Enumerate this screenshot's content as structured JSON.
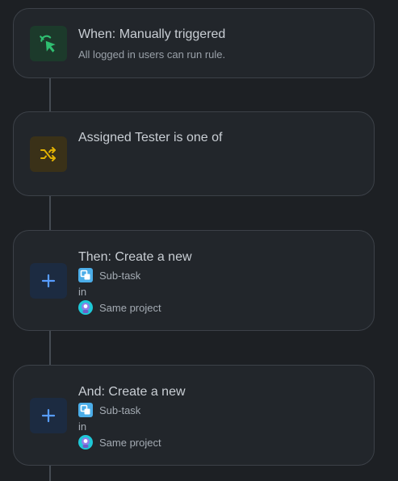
{
  "colors": {
    "background": "#1d2024",
    "card": "#22262b",
    "card_border": "#3c4148",
    "connector": "#454b53",
    "trigger_accent": "#2fbf71",
    "condition_accent": "#e2b203",
    "action_accent": "#579dff",
    "subtask_accent": "#4bade8",
    "project_accent": "#1fc8d8"
  },
  "trigger": {
    "icon": "cursor-click-icon",
    "title": "When: Manually triggered",
    "subtitle": "All logged in users can run rule."
  },
  "condition": {
    "icon": "shuffle-icon",
    "title": "Assigned Tester is one of"
  },
  "actions": [
    {
      "icon": "plus-icon",
      "title": "Then: Create a new",
      "issue_type_icon": "subtask-icon",
      "issue_type": "Sub-task",
      "in_label": "in",
      "project_icon": "project-avatar-icon",
      "project": "Same project"
    },
    {
      "icon": "plus-icon",
      "title": "And: Create a new",
      "issue_type_icon": "subtask-icon",
      "issue_type": "Sub-task",
      "in_label": "in",
      "project_icon": "project-avatar-icon",
      "project": "Same project"
    }
  ]
}
